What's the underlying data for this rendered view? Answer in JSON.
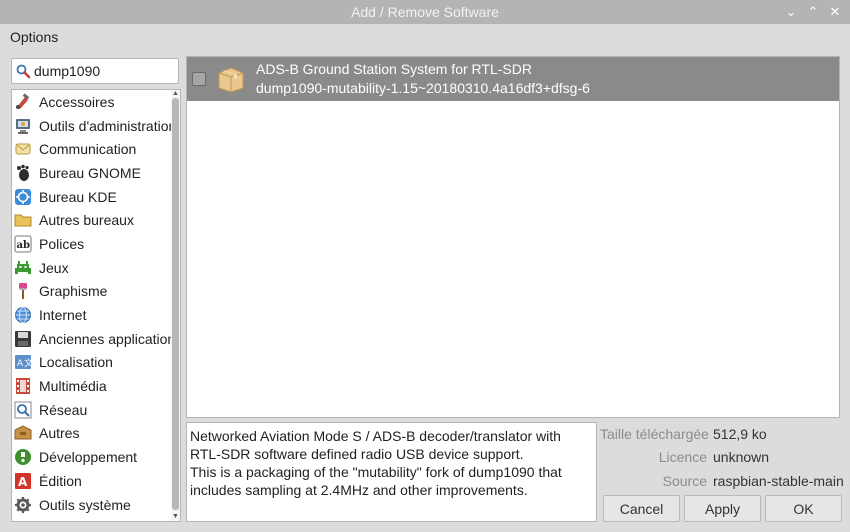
{
  "window": {
    "title": "Add / Remove Software",
    "controls": {
      "minimize": "⌄",
      "maximize": "⌃",
      "close": "✕"
    }
  },
  "menu": {
    "options": "Options"
  },
  "search": {
    "value": "dump1090",
    "icon": "search-icon"
  },
  "categories": [
    {
      "label": "Accessoires",
      "icon": "accessories-icon"
    },
    {
      "label": "Outils d'administration",
      "icon": "admin-tools-icon"
    },
    {
      "label": "Communication",
      "icon": "communication-icon"
    },
    {
      "label": "Bureau GNOME",
      "icon": "gnome-desktop-icon"
    },
    {
      "label": "Bureau KDE",
      "icon": "kde-desktop-icon"
    },
    {
      "label": "Autres bureaux",
      "icon": "other-desktops-icon"
    },
    {
      "label": "Polices",
      "icon": "fonts-icon"
    },
    {
      "label": "Jeux",
      "icon": "games-icon"
    },
    {
      "label": "Graphisme",
      "icon": "graphics-icon"
    },
    {
      "label": "Internet",
      "icon": "internet-icon"
    },
    {
      "label": "Anciennes applications",
      "icon": "legacy-apps-icon"
    },
    {
      "label": "Localisation",
      "icon": "localization-icon"
    },
    {
      "label": "Multimédia",
      "icon": "multimedia-icon"
    },
    {
      "label": "Réseau",
      "icon": "network-icon"
    },
    {
      "label": "Autres",
      "icon": "other-icon"
    },
    {
      "label": "Développement",
      "icon": "development-icon"
    },
    {
      "label": "Édition",
      "icon": "publishing-icon"
    },
    {
      "label": "Outils système",
      "icon": "system-tools-icon"
    }
  ],
  "packages": [
    {
      "summary": "ADS-B Ground Station System for RTL-SDR",
      "version": "dump1090-mutability-1.15~20180310.4a16df3+dfsg-6",
      "selected_row": true,
      "checked": false
    }
  ],
  "description": {
    "line1": "Networked Aviation Mode S / ADS-B decoder/translator with RTL-SDR software defined radio USB device support.",
    "line2": "This is a packaging of the \"mutability\" fork of dump1090 that includes sampling at 2.4MHz and other improvements."
  },
  "info": {
    "download_size_label": "Taille téléchargée",
    "download_size_value": "512,9 ko",
    "license_label": "Licence",
    "license_value": "unknown",
    "source_label": "Source",
    "source_value": "raspbian-stable-main"
  },
  "buttons": {
    "cancel": "Cancel",
    "apply": "Apply",
    "ok": "OK"
  },
  "colors": {
    "titlebar": "#b4b4b4",
    "selected_row": "#8a8a8a",
    "window_bg": "#dcdcdc"
  }
}
